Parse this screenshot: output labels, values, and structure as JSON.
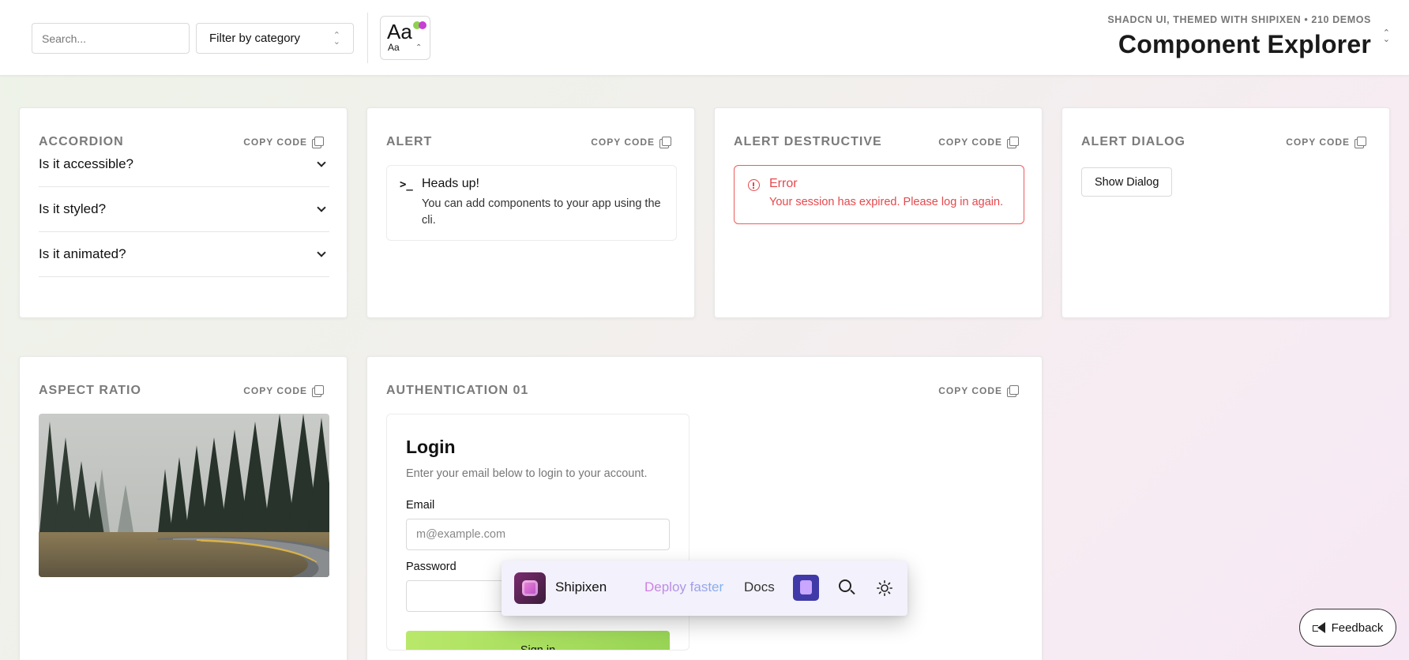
{
  "header": {
    "search_placeholder": "Search...",
    "filter_label": "Filter by category",
    "font_big": "Aa",
    "font_small": "Aa",
    "subtitle": "SHADCN UI, THEMED WITH SHIPIXEN • 210 DEMOS",
    "title": "Component Explorer"
  },
  "copy_label": "COPY CODE",
  "cards": {
    "accordion": {
      "title": "ACCORDION",
      "items": [
        "Is it accessible?",
        "Is it styled?",
        "Is it animated?"
      ]
    },
    "alert": {
      "title": "ALERT",
      "heading": "Heads up!",
      "description": "You can add components to your app using the cli."
    },
    "alert_destructive": {
      "title": "ALERT DESTRUCTIVE",
      "heading": "Error",
      "description": "Your session has expired. Please log in again."
    },
    "alert_dialog": {
      "title": "ALERT DIALOG",
      "button": "Show Dialog"
    },
    "aspect_ratio": {
      "title": "ASPECT RATIO"
    },
    "auth01": {
      "title": "AUTHENTICATION 01",
      "login_title": "Login",
      "login_desc": "Enter your email below to login to your account.",
      "email_label": "Email",
      "email_placeholder": "m@example.com",
      "password_label": "Password",
      "signin": "Sign in"
    }
  },
  "floatnav": {
    "brand": "Shipixen",
    "tagline": "Deploy faster",
    "docs": "Docs"
  },
  "feedback": "Feedback",
  "colors": {
    "error": "#e5484d",
    "accent_green": "#98d455",
    "accent_purple": "#c73fd3"
  }
}
